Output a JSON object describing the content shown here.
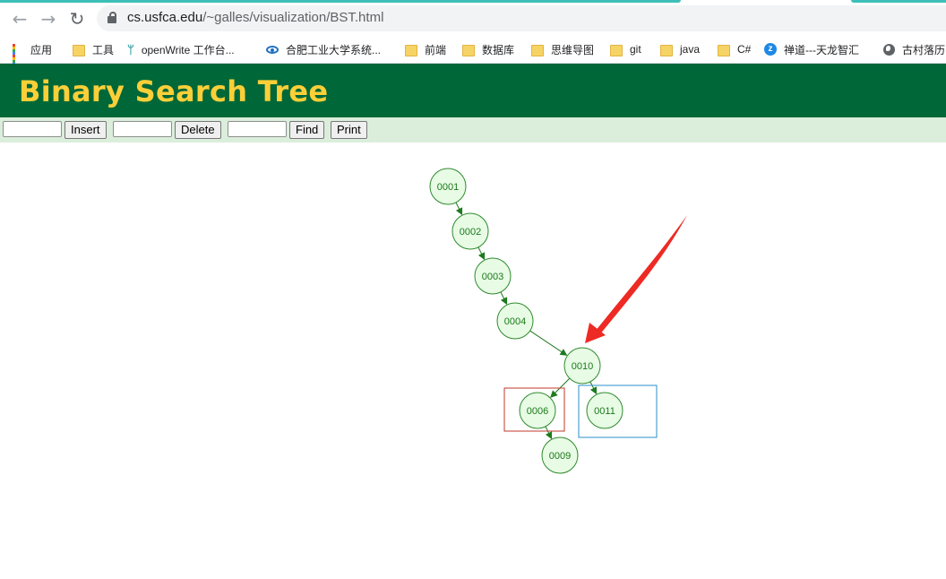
{
  "browser": {
    "url_domain": "cs.usfca.edu",
    "url_path": "/~galles/visualization/BST.html",
    "back_label": "←",
    "forward_label": "→",
    "reload_label": "↻"
  },
  "bookmarks": [
    {
      "label": "应用",
      "icon": "apps-grid-icon"
    },
    {
      "label": "工具",
      "icon": "folder-icon"
    },
    {
      "label": "openWrite 工作台...",
      "icon": "openwrite-icon"
    },
    {
      "label": "合肥工业大学系统...",
      "icon": "hfut-icon"
    },
    {
      "label": "前端",
      "icon": "folder-icon"
    },
    {
      "label": "数据库",
      "icon": "folder-icon"
    },
    {
      "label": "思维导图",
      "icon": "folder-icon"
    },
    {
      "label": "git",
      "icon": "folder-icon"
    },
    {
      "label": "java",
      "icon": "folder-icon"
    },
    {
      "label": "C#",
      "icon": "folder-icon"
    },
    {
      "label": "禅道---天龙智汇",
      "icon": "zentao-icon"
    },
    {
      "label": "古村落历",
      "icon": "globe-icon"
    }
  ],
  "page": {
    "title": "Binary Search Tree"
  },
  "controls": {
    "insert_label": "Insert",
    "delete_label": "Delete",
    "find_label": "Find",
    "print_label": "Print",
    "insert_value": "",
    "delete_value": "",
    "find_value": ""
  },
  "tree": {
    "nodes": [
      {
        "id": "n1",
        "label": "0001"
      },
      {
        "id": "n2",
        "label": "0002"
      },
      {
        "id": "n3",
        "label": "0003"
      },
      {
        "id": "n4",
        "label": "0004"
      },
      {
        "id": "n10",
        "label": "0010"
      },
      {
        "id": "n6",
        "label": "0006"
      },
      {
        "id": "n11",
        "label": "0011"
      },
      {
        "id": "n9",
        "label": "0009"
      }
    ],
    "edges": [
      [
        "n1",
        "n2"
      ],
      [
        "n2",
        "n3"
      ],
      [
        "n3",
        "n4"
      ],
      [
        "n4",
        "n10"
      ],
      [
        "n10",
        "n6"
      ],
      [
        "n10",
        "n11"
      ],
      [
        "n6",
        "n9"
      ]
    ]
  },
  "colors": {
    "header_bg": "#006838",
    "title_color": "#fccf38",
    "controls_bg": "#dbeedb",
    "node_fill": "#e8fbe5",
    "node_stroke": "#2e8b2e",
    "node_text": "#1a7a1a",
    "edge": "#1e7a1e",
    "highlight_left": "#c0392b",
    "highlight_right": "#2a8fc9",
    "annotation_arrow": "#ee2a24"
  }
}
